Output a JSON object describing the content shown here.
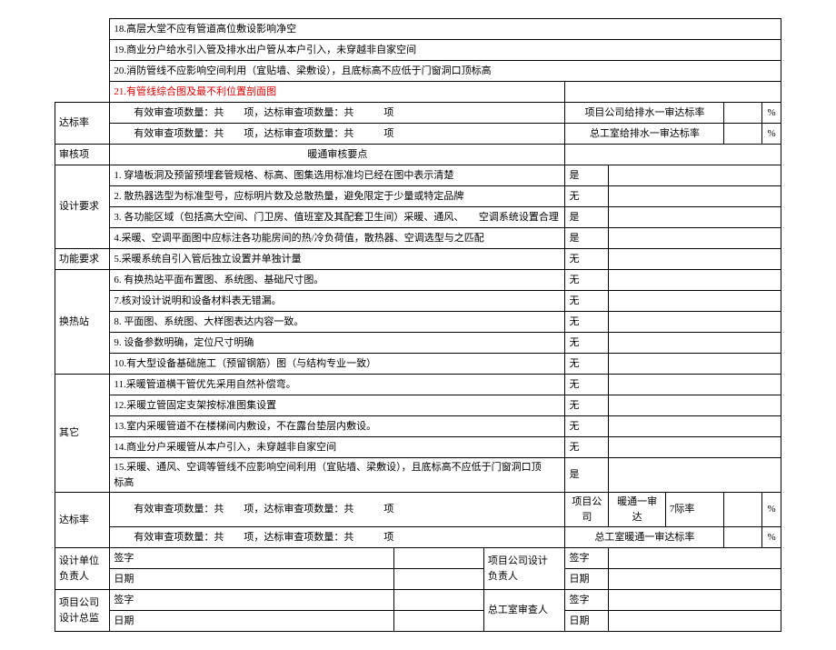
{
  "top_rows": [
    "18.高层大堂不应有管道高位敷设影响净空",
    "19.商业分户给水引入管及排水出户管从本户引入，未穿越非自家空间",
    "20.消防管线不应影响空间利用（宜贴墙、梁敷设），且底标高不应低于门窗洞口顶标高"
  ],
  "row21": "21.有管线综合图及最不利位置剖面图",
  "sec1": {
    "label": "达标率",
    "line1_a": "有效审查项数量：共",
    "line1_b": "项，达标审查项数量：共",
    "line1_c": "项",
    "right1": "项目公司给排水一审达标率",
    "right2": "总工室给排水一审达标率",
    "pct": "%"
  },
  "audit": {
    "label": "审核项",
    "title": "暖通审核要点"
  },
  "design": {
    "label": "设计要求",
    "rows": [
      "1. 穿墙板洞及预留预埋套管规格、标高、图集选用标准均已经在图中表示清楚",
      "2. 散热器选型为标准型号，应标明片数及总散热量，避免限定于少量或特定品牌",
      "3. 各功能区域（包括高大空间、门卫房、值班室及其配套卫生间）采暖、通风、　　空调系统设置合理",
      "4.采暖、空调平面图中应标注各功能房间的热/冷负荷值，散热器、空调选型与之匹配"
    ],
    "ans": [
      "是",
      "无",
      "是",
      "是"
    ]
  },
  "func": {
    "label": "功能要求",
    "row": "5.采暖系统自引入管后独立设置并单独计量",
    "ans": "无"
  },
  "heat": {
    "label": "换热站",
    "rows": [
      "6. 有换热站平面布置图、系统图、基础尺寸图。",
      "7.核对设计说明和设备材料表无错漏。",
      "8. 平面图、系统图、大样图表达内容一致。",
      "9. 设备参数明确，定位尺寸明确",
      "10.有大型设备基础施工（预留钢筋）图（与结构专业一致）"
    ],
    "ans": [
      "无",
      "无",
      "无",
      "无",
      "无"
    ]
  },
  "other": {
    "label": "其它",
    "rows": [
      "11.采暖管道横干管优先采用自然补偿弯。",
      "12.采暖立管固定支架按标准图集设置",
      "13.室内采暖管道不在楼梯间内敷设，不在露台垫层内敷设。",
      "14.商业分户采暖管从本户引入，未穿越非自家空间",
      "15.采暖、通风、空调等管线不应影响空间利用（宜贴墙、梁敷设），且底标高不应低于门窗洞口顶\n标高"
    ],
    "ans": [
      "无",
      "无",
      "无",
      "无",
      "是"
    ]
  },
  "sec2": {
    "label": "达标率",
    "right1a": "项目公司",
    "right1b": "暖通一审达",
    "right1c": "7际率",
    "right2": "总工室暖通一审达标率",
    "pct": "%"
  },
  "sign": {
    "design_unit": "设计单位\n负责人",
    "proj_design": "项目公司设计\n负责人",
    "proj_director": "项目公司\n设计总监",
    "chief_reviewer": "总工室审查人",
    "sig": "签字",
    "date": "日期"
  }
}
